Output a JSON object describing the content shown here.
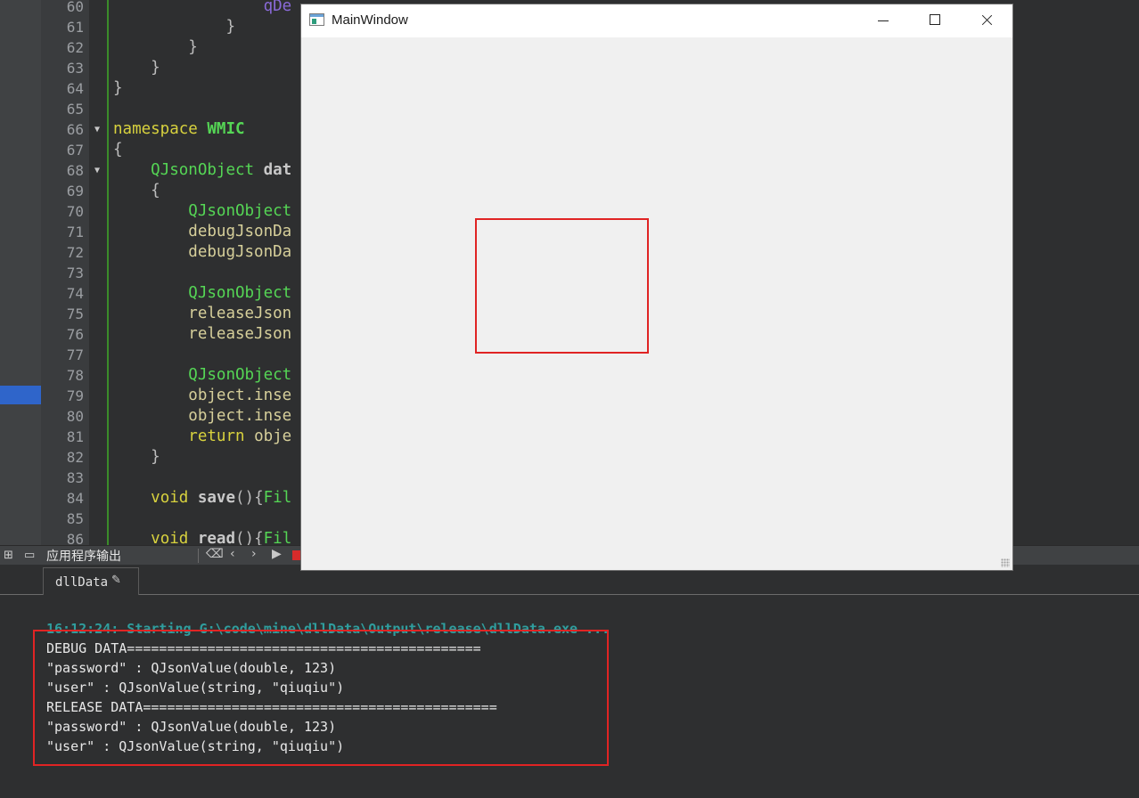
{
  "editor": {
    "lines": [
      {
        "num": "60",
        "fold": "",
        "tokens": [
          {
            "t": "                ",
            "c": ""
          },
          {
            "t": "qDe",
            "c": "call"
          }
        ]
      },
      {
        "num": "61",
        "fold": "",
        "tokens": [
          {
            "t": "            ",
            "c": ""
          },
          {
            "t": "}",
            "c": "br"
          }
        ]
      },
      {
        "num": "62",
        "fold": "",
        "tokens": [
          {
            "t": "        ",
            "c": ""
          },
          {
            "t": "}",
            "c": "br"
          }
        ]
      },
      {
        "num": "63",
        "fold": "",
        "tokens": [
          {
            "t": "    ",
            "c": ""
          },
          {
            "t": "}",
            "c": "br"
          }
        ]
      },
      {
        "num": "64",
        "fold": "",
        "tokens": [
          {
            "t": "}",
            "c": "br"
          }
        ]
      },
      {
        "num": "65",
        "fold": "",
        "tokens": []
      },
      {
        "num": "66",
        "fold": "▼",
        "tokens": [
          {
            "t": "namespace",
            "c": "kw"
          },
          {
            "t": " ",
            "c": ""
          },
          {
            "t": "WMIC",
            "c": "ns"
          }
        ]
      },
      {
        "num": "67",
        "fold": "",
        "tokens": [
          {
            "t": "{",
            "c": "br"
          }
        ]
      },
      {
        "num": "68",
        "fold": "▼",
        "tokens": [
          {
            "t": "    ",
            "c": ""
          },
          {
            "t": "QJsonObject",
            "c": "ty"
          },
          {
            "t": " ",
            "c": ""
          },
          {
            "t": "dat",
            "c": "fn"
          }
        ]
      },
      {
        "num": "69",
        "fold": "",
        "tokens": [
          {
            "t": "    ",
            "c": ""
          },
          {
            "t": "{",
            "c": "br"
          }
        ]
      },
      {
        "num": "70",
        "fold": "",
        "tokens": [
          {
            "t": "        ",
            "c": ""
          },
          {
            "t": "QJsonObject",
            "c": "ty"
          }
        ]
      },
      {
        "num": "71",
        "fold": "",
        "tokens": [
          {
            "t": "        ",
            "c": ""
          },
          {
            "t": "debugJsonDa",
            "c": "va"
          }
        ]
      },
      {
        "num": "72",
        "fold": "",
        "tokens": [
          {
            "t": "        ",
            "c": ""
          },
          {
            "t": "debugJsonDa",
            "c": "va"
          }
        ]
      },
      {
        "num": "73",
        "fold": "",
        "tokens": []
      },
      {
        "num": "74",
        "fold": "",
        "tokens": [
          {
            "t": "        ",
            "c": ""
          },
          {
            "t": "QJsonObject",
            "c": "ty"
          }
        ]
      },
      {
        "num": "75",
        "fold": "",
        "tokens": [
          {
            "t": "        ",
            "c": ""
          },
          {
            "t": "releaseJson",
            "c": "va"
          }
        ]
      },
      {
        "num": "76",
        "fold": "",
        "tokens": [
          {
            "t": "        ",
            "c": ""
          },
          {
            "t": "releaseJson",
            "c": "va"
          }
        ]
      },
      {
        "num": "77",
        "fold": "",
        "tokens": []
      },
      {
        "num": "78",
        "fold": "",
        "tokens": [
          {
            "t": "        ",
            "c": ""
          },
          {
            "t": "QJsonObject",
            "c": "ty"
          }
        ]
      },
      {
        "num": "79",
        "fold": "",
        "tokens": [
          {
            "t": "        ",
            "c": ""
          },
          {
            "t": "object.inse",
            "c": "va"
          }
        ]
      },
      {
        "num": "80",
        "fold": "",
        "tokens": [
          {
            "t": "        ",
            "c": ""
          },
          {
            "t": "object.inse",
            "c": "va"
          }
        ]
      },
      {
        "num": "81",
        "fold": "",
        "tokens": [
          {
            "t": "        ",
            "c": ""
          },
          {
            "t": "return",
            "c": "kw"
          },
          {
            "t": " ",
            "c": ""
          },
          {
            "t": "obje",
            "c": "va"
          }
        ]
      },
      {
        "num": "82",
        "fold": "",
        "tokens": [
          {
            "t": "    ",
            "c": ""
          },
          {
            "t": "}",
            "c": "br"
          }
        ]
      },
      {
        "num": "83",
        "fold": "",
        "tokens": []
      },
      {
        "num": "84",
        "fold": "",
        "tokens": [
          {
            "t": "    ",
            "c": ""
          },
          {
            "t": "void",
            "c": "kw"
          },
          {
            "t": " ",
            "c": ""
          },
          {
            "t": "save",
            "c": "fn"
          },
          {
            "t": "(){",
            "c": "br"
          },
          {
            "t": "Fil",
            "c": "ty"
          }
        ]
      },
      {
        "num": "85",
        "fold": "",
        "tokens": []
      },
      {
        "num": "86",
        "fold": "",
        "tokens": [
          {
            "t": "    ",
            "c": ""
          },
          {
            "t": "void",
            "c": "kw"
          },
          {
            "t": " ",
            "c": ""
          },
          {
            "t": "read",
            "c": "fn"
          },
          {
            "t": "(){",
            "c": "br"
          },
          {
            "t": "Fil",
            "c": "ty"
          }
        ]
      }
    ]
  },
  "output_panel": {
    "title": "应用程序输出",
    "tab_label": "dllData",
    "start_line": "16:12:24: Starting G:\\code\\mine\\dllData\\Output\\release\\dllData.exe ...",
    "lines": [
      "DEBUG DATA============================================",
      "\"password\" : QJsonValue(double, 123)",
      "\"user\" : QJsonValue(string, \"qiuqiu\")",
      "RELEASE DATA============================================",
      "\"password\" : QJsonValue(double, 123)",
      "\"user\" : QJsonValue(string, \"qiuqiu\")"
    ]
  },
  "main_window": {
    "title": "MainWindow"
  },
  "colors": {
    "editor_bg": "#2e2f30",
    "highlight_red": "#e02424",
    "keyword": "#d8d23e",
    "type": "#55d655"
  }
}
